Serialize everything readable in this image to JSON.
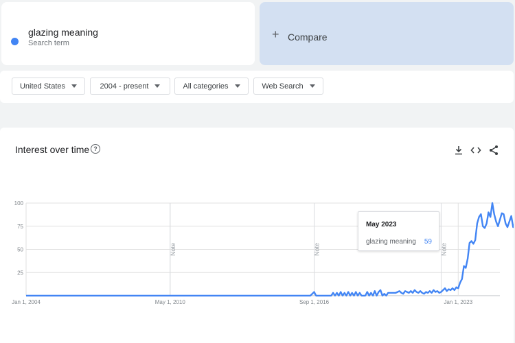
{
  "search_term": {
    "label": "glazing meaning",
    "sublabel": "Search term",
    "color": "#4285f4"
  },
  "compare": {
    "icon": "plus-icon",
    "label": "Compare"
  },
  "filters": [
    {
      "label": "United States"
    },
    {
      "label": "2004 - present"
    },
    {
      "label": "All categories"
    },
    {
      "label": "Web Search"
    }
  ],
  "chart_panel": {
    "title": "Interest over time",
    "help_icon": "help-circle-icon",
    "actions": [
      "download-icon",
      "embed-code-icon",
      "share-icon"
    ]
  },
  "tooltip": {
    "date": "May 2023",
    "term": "glazing meaning",
    "value": "59"
  },
  "chart_data": {
    "type": "line",
    "title": "",
    "xlabel": "",
    "ylabel": "",
    "ylim": [
      0,
      100
    ],
    "yticks": [
      25,
      50,
      75,
      100
    ],
    "xlim": [
      "2004-01",
      "2024-11"
    ],
    "xticks": [
      {
        "date": "2004-01",
        "label": "Jan 1, 2004"
      },
      {
        "date": "2010-05",
        "label": "May 1, 2010"
      },
      {
        "date": "2016-09",
        "label": "Sep 1, 2016"
      },
      {
        "date": "2023-01",
        "label": "Jan 1, 2023"
      }
    ],
    "annotations": [
      {
        "date": "2010-05",
        "label": "Note"
      },
      {
        "date": "2016-09",
        "label": "Note"
      },
      {
        "date": "2022-04",
        "label": "Note"
      }
    ],
    "grid": true,
    "color": "#4285f4",
    "series": [
      {
        "name": "glazing meaning",
        "points": [
          [
            "2004-01",
            0
          ],
          [
            "2016-07",
            0
          ],
          [
            "2016-08",
            2
          ],
          [
            "2016-09",
            4
          ],
          [
            "2016-10",
            0
          ],
          [
            "2017-06",
            0
          ],
          [
            "2017-07",
            3
          ],
          [
            "2017-08",
            0
          ],
          [
            "2017-09",
            3
          ],
          [
            "2017-10",
            0
          ],
          [
            "2017-11",
            4
          ],
          [
            "2017-12",
            0
          ],
          [
            "2018-01",
            3
          ],
          [
            "2018-02",
            0
          ],
          [
            "2018-03",
            4
          ],
          [
            "2018-04",
            0
          ],
          [
            "2018-05",
            3
          ],
          [
            "2018-06",
            0
          ],
          [
            "2018-07",
            4
          ],
          [
            "2018-08",
            0
          ],
          [
            "2018-09",
            3
          ],
          [
            "2018-10",
            0
          ],
          [
            "2018-12",
            0
          ],
          [
            "2019-01",
            4
          ],
          [
            "2019-02",
            0
          ],
          [
            "2019-03",
            3
          ],
          [
            "2019-04",
            0
          ],
          [
            "2019-05",
            5
          ],
          [
            "2019-06",
            0
          ],
          [
            "2019-07",
            4
          ],
          [
            "2019-08",
            6
          ],
          [
            "2019-09",
            0
          ],
          [
            "2019-10",
            2
          ],
          [
            "2019-11",
            0
          ],
          [
            "2019-12",
            3
          ],
          [
            "2020-01",
            3
          ],
          [
            "2020-03",
            3
          ],
          [
            "2020-04",
            3
          ],
          [
            "2020-05",
            4
          ],
          [
            "2020-06",
            5
          ],
          [
            "2020-07",
            3
          ],
          [
            "2020-08",
            2
          ],
          [
            "2020-09",
            5
          ],
          [
            "2020-10",
            4
          ],
          [
            "2020-11",
            3
          ],
          [
            "2020-12",
            5
          ],
          [
            "2021-01",
            3
          ],
          [
            "2021-02",
            6
          ],
          [
            "2021-03",
            4
          ],
          [
            "2021-04",
            3
          ],
          [
            "2021-05",
            5
          ],
          [
            "2021-06",
            3
          ],
          [
            "2021-07",
            2
          ],
          [
            "2021-08",
            4
          ],
          [
            "2021-09",
            3
          ],
          [
            "2021-10",
            5
          ],
          [
            "2021-11",
            3
          ],
          [
            "2021-12",
            6
          ],
          [
            "2022-01",
            4
          ],
          [
            "2022-02",
            5
          ],
          [
            "2022-03",
            3
          ],
          [
            "2022-04",
            4
          ],
          [
            "2022-05",
            6
          ],
          [
            "2022-06",
            8
          ],
          [
            "2022-07",
            5
          ],
          [
            "2022-08",
            7
          ],
          [
            "2022-09",
            6
          ],
          [
            "2022-10",
            8
          ],
          [
            "2022-11",
            6
          ],
          [
            "2022-12",
            9
          ],
          [
            "2023-01",
            8
          ],
          [
            "2023-02",
            14
          ],
          [
            "2023-03",
            18
          ],
          [
            "2023-04",
            32
          ],
          [
            "2023-05",
            30
          ],
          [
            "2023-06",
            40
          ],
          [
            "2023-07",
            57
          ],
          [
            "2023-08",
            59
          ],
          [
            "2023-09",
            56
          ],
          [
            "2023-10",
            60
          ],
          [
            "2023-11",
            78
          ],
          [
            "2023-12",
            85
          ],
          [
            "2024-01",
            88
          ],
          [
            "2024-02",
            75
          ],
          [
            "2024-03",
            73
          ],
          [
            "2024-04",
            78
          ],
          [
            "2024-05",
            90
          ],
          [
            "2024-06",
            85
          ],
          [
            "2024-07",
            100
          ],
          [
            "2024-08",
            88
          ],
          [
            "2024-09",
            80
          ],
          [
            "2024-10",
            75
          ],
          [
            "2024-11",
            82
          ],
          [
            "2024-12",
            89
          ],
          [
            "2025-01",
            88
          ],
          [
            "2025-02",
            78
          ],
          [
            "2025-03",
            74
          ],
          [
            "2025-04",
            80
          ],
          [
            "2025-05",
            86
          ],
          [
            "2025-06",
            74
          ],
          [
            "2025-07",
            79
          ],
          [
            "2025-08",
            77
          ],
          [
            "2025-09",
            80
          ]
        ]
      }
    ]
  }
}
